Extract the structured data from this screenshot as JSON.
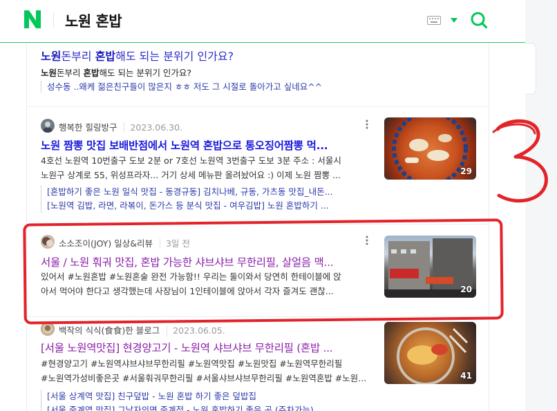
{
  "header": {
    "logo_letter": "N",
    "query": "노원 혼밥",
    "brand_color": "#03c75a"
  },
  "qa": {
    "title_bold": "노원",
    "title_mid1": "돈부리 ",
    "title_bold2": "혼밥",
    "title_rest": "해도 되는 분위기 인가요?",
    "desc_bold": "노원",
    "desc_mid": "돈부리 ",
    "desc_bold2": "혼밥",
    "desc_rest": "해도 되는 분위기 인가요?",
    "sub": "성수동 ..왜케 젊은친구들이 많은지 ㅎㅎ 저도 그 시절로 돌아가고 싶네요^^"
  },
  "results": [
    {
      "author": "행복한 힐링방구",
      "date": "2023.06.30.",
      "title": "노원 짬뽕 맛집 보배반점에서 노원역 혼밥으로 통오징어짬뽕 먹...",
      "desc_line1": "4호선 노원역 10번출구 도보 2분 or 7호선 노원역 3번출구 도보 3분 주소 : 서울시",
      "desc_line2": "노원구 상계로 55, 위성프라자... 거기 상세 메뉴판 올려놨어요 :) 이제 노원 짬뽕 ...",
      "sub_links": [
        "[혼밥하기 좋은 노원 일식 맛집 - 동경규동] 김치나베, 규동, 가츠동 맛집_내돈...",
        "[노원역 김밥, 라면, 라볶이, 돈가스 등 분식 맛집 - 여우김밥] 노원 혼밥하기 ..."
      ],
      "thumb_count": "29",
      "visited": false
    },
    {
      "author": "소소조이(JOY) 일상&리뷰",
      "date": "3일 전",
      "title": "서울 / 노원 훠궈 맛집, 혼밥 가능한 샤브샤브 무한리필, 살얼음 맥...",
      "desc_line1": "있어서 #노원혼밥 #노원혼술 완전 가능함!! 우리는 둘이와서 당연히 한테이블에 앉",
      "desc_line2": "아서 먹어야 한다고 생각했는데 사장님이 1인테이블에 앉아서 각자 즐겨도 괜찮...",
      "thumb_count": "20",
      "visited": true
    },
    {
      "author": "백작의 식식(食食)한 블로그",
      "date": "2023.06.05.",
      "title": "[서울 노원역맛집] 현경양고기 - 노원역 샤브샤브 무한리필 (혼밥 ...",
      "desc_line1": "#현경양고기 #노원역샤브샤브무한리필 #노원역맛집 #노원맛집 #노원역무한리필",
      "desc_line2": "#노원역가성비좋은곳 #서울훠궈무한리필 #서울샤브샤브무한리필 #노원역혼밥 #노원...",
      "sub_links": [
        "[서울 상계역 맛집] 친구덮밥 - 노원 혼밥 하기 좋은 덮밥집",
        "[서울 중계역 맛집] 그남자의면 중계점 - 노원 혼밥하기 좋은 곳 (주차가능)"
      ],
      "thumb_count": "41",
      "visited": true
    }
  ],
  "annotation": {
    "number": "3",
    "color": "#e2242a"
  }
}
